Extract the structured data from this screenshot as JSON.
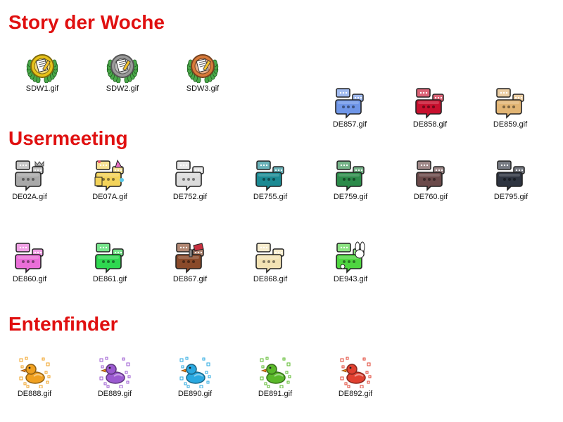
{
  "sections": {
    "story": {
      "title": "Story der Woche"
    },
    "usermeeting": {
      "title": "Usermeeting"
    },
    "entenfinder": {
      "title": "Entenfinder"
    }
  },
  "files": {
    "SDW1": {
      "name": "SDW1.gif",
      "icon": "gold-seal-icon",
      "color": "#e8c21a"
    },
    "SDW2": {
      "name": "SDW2.gif",
      "icon": "silver-seal-icon",
      "color": "#9a9a9a"
    },
    "SDW3": {
      "name": "SDW3.gif",
      "icon": "bronze-seal-icon",
      "color": "#d87a3a"
    },
    "DE857": {
      "name": "DE857.gif",
      "icon": "chat-bubble-icon",
      "color": "#6f96e8"
    },
    "DE858": {
      "name": "DE858.gif",
      "icon": "chat-bubble-icon",
      "color": "#c8102e"
    },
    "DE859": {
      "name": "DE859.gif",
      "icon": "chat-bubble-icon",
      "color": "#e2b574"
    },
    "DE02A": {
      "name": "DE02A.gif",
      "icon": "chat-bubble-crown-icon",
      "color": "#a9a9a9"
    },
    "DE07A": {
      "name": "DE07A.gif",
      "icon": "chat-bubble-party-icon",
      "color": "#f3d35a"
    },
    "DE752": {
      "name": "DE752.gif",
      "icon": "chat-bubble-icon",
      "color": "#dcdcdc"
    },
    "DE755": {
      "name": "DE755.gif",
      "icon": "chat-bubble-icon",
      "color": "#1b8a93"
    },
    "DE759": {
      "name": "DE759.gif",
      "icon": "chat-bubble-icon",
      "color": "#2c8b4a"
    },
    "DE760": {
      "name": "DE760.gif",
      "icon": "chat-bubble-icon",
      "color": "#6b4a4a"
    },
    "DE795": {
      "name": "DE795.gif",
      "icon": "chat-bubble-icon",
      "color": "#2e3440"
    },
    "DE860": {
      "name": "DE860.gif",
      "icon": "chat-bubble-icon",
      "color": "#ea6ed8"
    },
    "DE861": {
      "name": "DE861.gif",
      "icon": "chat-bubble-icon",
      "color": "#2fd850"
    },
    "DE867": {
      "name": "DE867.gif",
      "icon": "chat-bubble-paint-icon",
      "color": "#8a4a2a"
    },
    "DE868": {
      "name": "DE868.gif",
      "icon": "chat-bubble-icon",
      "color": "#f3e3b4"
    },
    "DE943": {
      "name": "DE943.gif",
      "icon": "chat-bubble-bunny-icon",
      "color": "#4fd640"
    },
    "DE888": {
      "name": "DE888.gif",
      "icon": "duck-icon",
      "color": "#f0a020"
    },
    "DE889": {
      "name": "DE889.gif",
      "icon": "duck-icon",
      "color": "#9b5ad0"
    },
    "DE890": {
      "name": "DE890.gif",
      "icon": "duck-icon",
      "color": "#2aa8e0"
    },
    "DE891": {
      "name": "DE891.gif",
      "icon": "duck-icon",
      "color": "#5ab82a"
    },
    "DE892": {
      "name": "DE892.gif",
      "icon": "duck-icon",
      "color": "#e04030"
    }
  }
}
